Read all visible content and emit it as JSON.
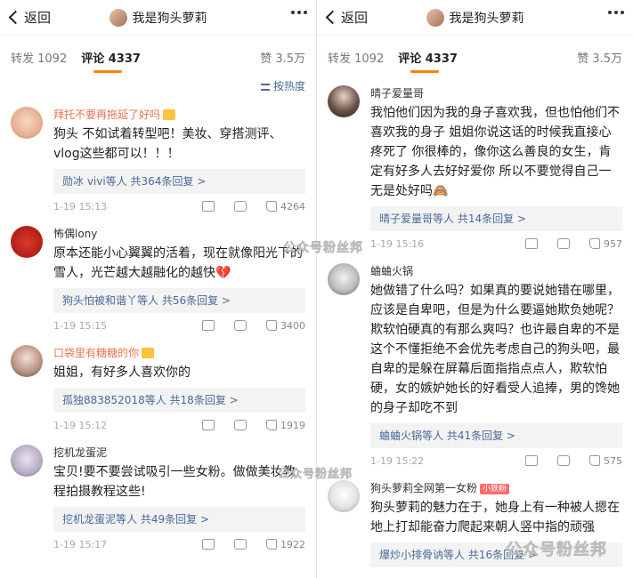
{
  "header": {
    "back_label": "返回",
    "title": "我是狗头萝莉"
  },
  "tabs": {
    "repost": "转发 1092",
    "comment": "评论 4337",
    "likes": "赞 3.5万"
  },
  "sort_label": "按热度",
  "left_comments": [
    {
      "name": "拜托不要再拖延了好吗",
      "text": "狗头 不如试着转型吧！美妆、穿搭测评、vlog这些都可以！！！",
      "reply_users": "勋冰 vivi等人",
      "reply_count": "共364条回复 >",
      "time": "1-19 15:13",
      "likes": "4264"
    },
    {
      "name": "怖偶lony",
      "text": "原本还能小心翼翼的活着，现在就像阳光下的雪人，光芒越大越融化的越快💔",
      "reply_users": "狗头怕被和谐丫等人",
      "reply_count": "共56条回复 >",
      "time": "1-19 15:15",
      "likes": "3400"
    },
    {
      "name": "口袋里有糖糖的你",
      "text": "姐姐，有好多人喜欢你的",
      "reply_users": "孤独883852018等人",
      "reply_count": "共18条回复 >",
      "time": "1-19 15:12",
      "likes": "1919"
    },
    {
      "name": "挖机龙蛋泥",
      "text": "宝贝!要不要尝试吸引一些女粉。做做美妆教程拍摄教程这些!",
      "reply_users": "挖机龙蛋泥等人",
      "reply_count": "共49条回复 >",
      "time": "1-19 15:17",
      "likes": "1922"
    }
  ],
  "right_comments": [
    {
      "name": "晴子爱量哥",
      "text": "我怕他们因为我的身子喜欢我，但也怕他们不喜欢我的身子 姐姐你说这话的时候我直接心疼死了 你很棒的，像你这么善良的女生，肯定有好多人去好好爱你 所以不要觉得自己一无是处好吗🙈",
      "reply_users": "晴子爱量哥等人",
      "reply_count": "共14条回复 >",
      "time": "1-19 15:16",
      "likes": "957"
    },
    {
      "name": "蛐蛐火锅",
      "text": "她做错了什么吗？如果真的要说她错在哪里，应该是自卑吧，但是为什么要逼她欺负她呢？欺软怕硬真的有那么爽吗？也许最自卑的不是这个不懂拒绝不会优先考虑自己的狗头吧，最自卑的是躲在屏幕后面指指点点人，欺软怕硬，女的嫉妒她长的好看受人追捧，男的馋她的身子却吃不到",
      "reply_users": "蛐蛐火锅等人",
      "reply_count": "共41条回复 >",
      "time": "1-19 15:22",
      "likes": "575"
    },
    {
      "name": "狗头萝莉全网第一女粉",
      "tag": "小铁粉",
      "text": "狗头萝莉的魅力在于，她身上有一种被人摁在地上打却能奋力爬起来朝人竖中指的顽强",
      "reply_users": "爆炒小排骨讷等人",
      "reply_count": "共16条回复 >"
    }
  ],
  "watermarks": [
    "公众号粉丝邦",
    "公众号粉丝邦",
    "公众号粉丝邦"
  ],
  "colors": {
    "accent": "#ff8200",
    "link": "#4a6a9a",
    "highlight_name": "#eb7350"
  }
}
